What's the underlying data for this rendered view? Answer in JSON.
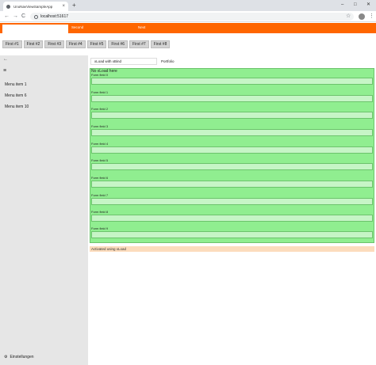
{
  "browser": {
    "tab_title": "UnoNavViewSampleApp",
    "tab_close": "×",
    "new_tab": "+",
    "url": "localhost:51617",
    "win_minimize": "–",
    "win_maximize": "□",
    "win_close": "✕",
    "back": "←",
    "forward": "→",
    "reload": "C",
    "star": "☆",
    "menu": "⋮"
  },
  "topnav": {
    "second": "Second",
    "next": "Next"
  },
  "first_buttons": [
    "First #1",
    "First #2",
    "First #3",
    "First #4",
    "First #5",
    "First #6",
    "First #7",
    "First #8"
  ],
  "sidebar": {
    "back_arrow": "←",
    "hamburger": "≡",
    "items": [
      "Menu item 1",
      "Menu item 6",
      "Menu item 10"
    ],
    "settings_icon": "⚙",
    "settings_label": "Einstellungen"
  },
  "inner_tabs": {
    "active": "xLoad with xBind",
    "other": "Portfolio"
  },
  "xload": {
    "title": "No xLoad here",
    "fields": [
      "Form field 0",
      "Form field 1",
      "Form field 2",
      "Form field 3",
      "Form field 4",
      "Form field 5",
      "Form field 6",
      "Form field 7",
      "Form field 8",
      "Form field 9"
    ]
  },
  "activated_text": "Activated using xLoad",
  "colors": {
    "accent": "#ff6600",
    "panel_green": "#90ee90",
    "input_green": "#c6f5c6",
    "activated_bg": "#fcdcbd"
  }
}
